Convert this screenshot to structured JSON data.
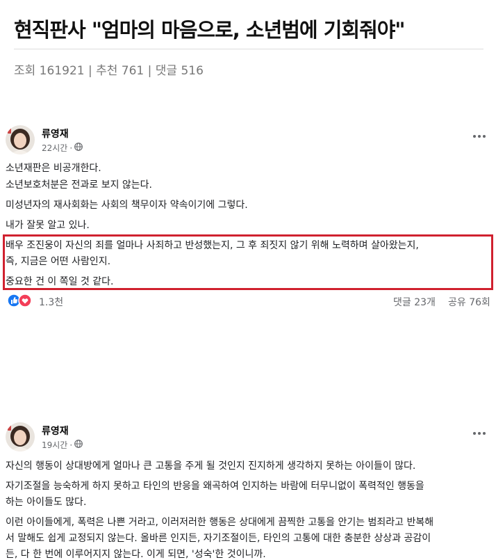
{
  "article": {
    "title": "현직판사 \"엄마의 마음으로, 소년범에 기회줘야\"",
    "stats": "조회 161921 | 추천 761 | 댓글 516"
  },
  "posts": [
    {
      "author": "류영재",
      "time": "22시간",
      "dot": "·",
      "paragraphs": [
        "소년재판은 비공개한다.",
        "소년보호처분은 전과로 보지 않는다.",
        "미성년자의 재사회화는 사회의 책무이자 약속이기에 그렇다.",
        "내가 잘못 알고 있나.",
        "배우 조진웅이 자신의 죄를 얼마나 사죄하고 반성했는지, 그 후 죄짓지 않기 위해 노력하며 살아왔는지,",
        "즉, 지금은 어떤 사람인지.",
        "중요한 건 이 쪽일 것 같다."
      ],
      "reactions": "1.3천",
      "comments": "댓글 23개",
      "shares": "공유 76회"
    },
    {
      "author": "류영재",
      "time": "19시간",
      "dot": "·",
      "paragraphs": [
        "자신의 행동이 상대방에게 얼마나 큰 고통을 주게 될 것인지 진지하게 생각하지 못하는 아이들이 많다.",
        "자기조절을 능숙하게 하지 못하고 타인의 반응을 왜곡하여 인지하는 바람에 터무니없이 폭력적인 행동을",
        "하는 아이들도 많다.",
        "이런 아이들에게, 폭력은 나쁜 거라고, 이러저러한 행동은 상대에게 끔찍한 고통을 안기는 범죄라고 반복해",
        "서 말해도 쉽게 교정되지 않는다. 올바른 인지든, 자기조절이든, 타인의 고통에 대한 충분한 상상과 공감이",
        "든, 다 한 번에 이루어지지 않는다. 이게 되면, '성숙'한 것이니까."
      ]
    }
  ],
  "colors": {
    "highlight": "#d0212f",
    "like_blue": "#1877f2",
    "love_red": "#f33e58"
  },
  "icons": [
    "globe-icon",
    "more-options-icon",
    "like-reaction-icon",
    "love-reaction-icon"
  ]
}
